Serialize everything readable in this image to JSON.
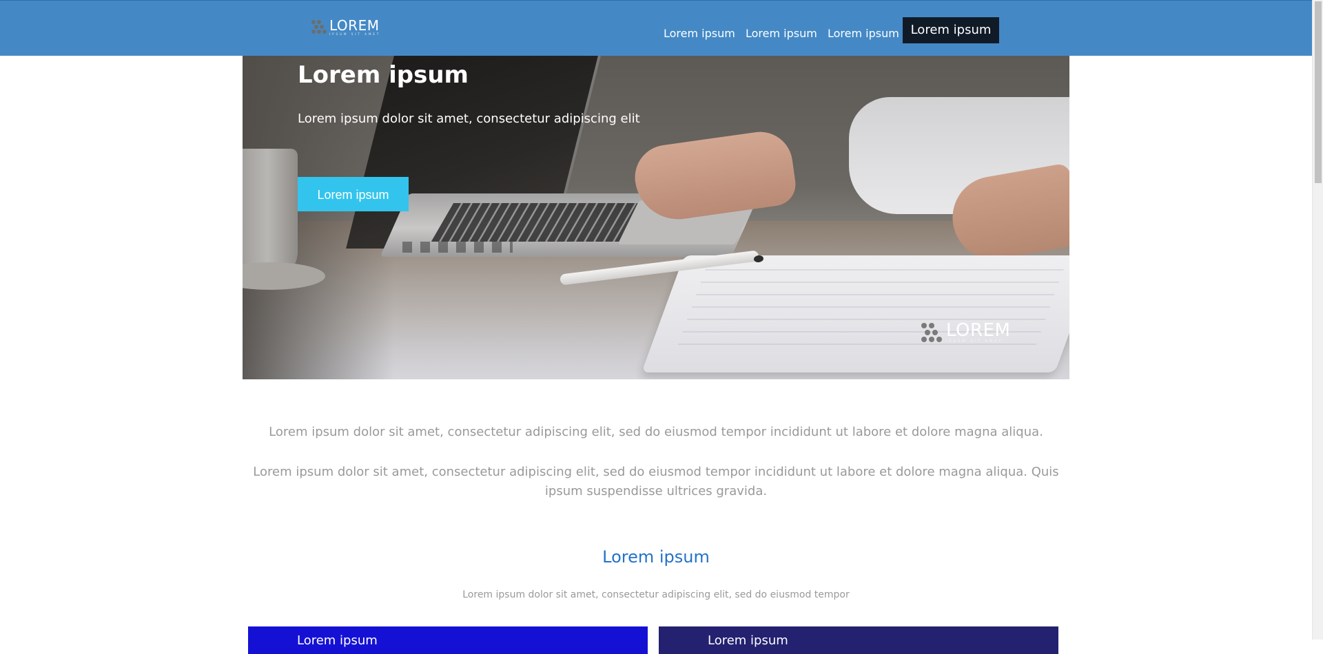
{
  "header": {
    "logo": {
      "word": "LOREM",
      "tagline": "IPSUM SIT AMET"
    },
    "nav": [
      {
        "label": "Lorem ipsum"
      },
      {
        "label": "Lorem ipsum"
      },
      {
        "label": "Lorem ipsum"
      },
      {
        "label": "Lorem ipsum",
        "active": true
      }
    ]
  },
  "hero": {
    "title": "Lorem ipsum",
    "subtitle": "Lorem ipsum dolor sit amet, consectetur adipiscing elit",
    "cta_label": "Lorem ipsum",
    "watermark": {
      "word": "LOREM",
      "tagline": "IPSUM SIT AMET"
    }
  },
  "intro": {
    "paragraph_1": "Lorem ipsum dolor sit amet, consectetur adipiscing elit, sed do eiusmod tempor incididunt ut labore et dolore magna aliqua.",
    "paragraph_2": "Lorem ipsum dolor sit amet, consectetur adipiscing elit, sed do eiusmod tempor incididunt ut labore et dolore magna aliqua. Quis ipsum suspendisse ultrices gravida."
  },
  "section": {
    "title": "Lorem ipsum",
    "subtitle": "Lorem ipsum dolor sit amet, consectetur adipiscing elit, sed do eiusmod tempor"
  },
  "cards": [
    {
      "title": "Lorem ipsum",
      "color": "#1511d4"
    },
    {
      "title": "Lorem ipsum",
      "color": "#232170"
    }
  ],
  "colors": {
    "header_bg": "#4489c6",
    "nav_active_bg": "#111b28",
    "cta_bg": "#33c4ed",
    "section_title": "#2372c9",
    "body_text": "#999999"
  }
}
